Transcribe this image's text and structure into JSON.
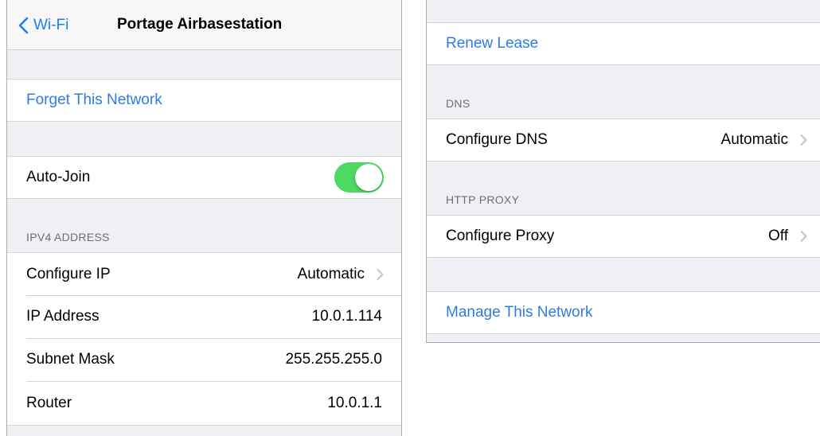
{
  "left": {
    "nav": {
      "back_label": "Wi-Fi",
      "title": "Portage Airbasestation"
    },
    "forget_label": "Forget This Network",
    "auto_join": {
      "label": "Auto-Join",
      "on": true
    },
    "ipv4_header": "IPV4 ADDRESS",
    "rows": [
      {
        "label": "Configure IP",
        "value": "Automatic"
      },
      {
        "label": "IP Address",
        "value": "10.0.1.114"
      },
      {
        "label": "Subnet Mask",
        "value": "255.255.255.0"
      },
      {
        "label": "Router",
        "value": "10.0.1.1"
      }
    ]
  },
  "right": {
    "renew_label": "Renew Lease",
    "dns_header": "DNS",
    "configure_dns": {
      "label": "Configure DNS",
      "value": "Automatic"
    },
    "proxy_header": "HTTP PROXY",
    "configure_proxy": {
      "label": "Configure Proxy",
      "value": "Off"
    },
    "manage_label": "Manage This Network"
  },
  "colors": {
    "link": "#2f7be4",
    "toggle_on": "#4cd964",
    "group_bg": "#efeff4"
  }
}
